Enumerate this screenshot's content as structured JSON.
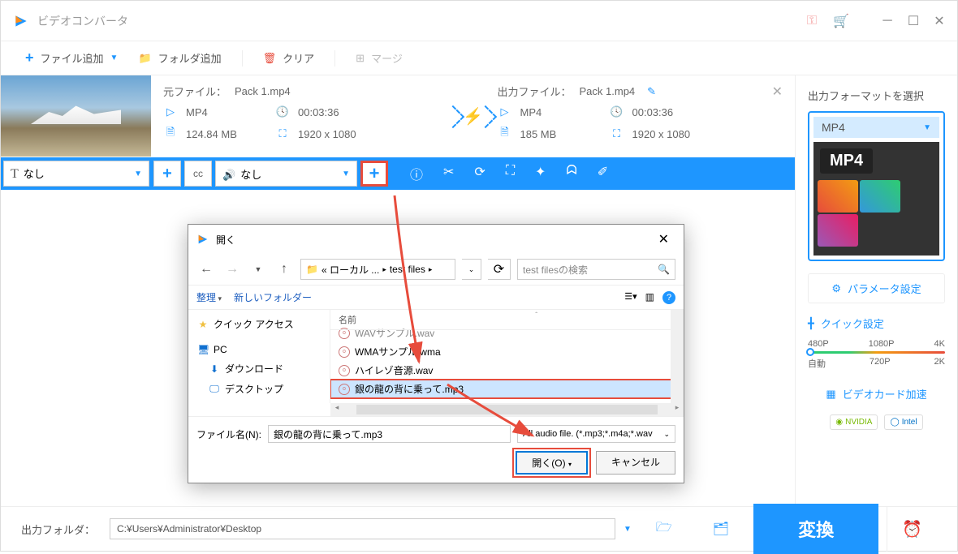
{
  "app": {
    "title": "ビデオコンバータ"
  },
  "toolbar": {
    "add_file": "ファイル追加",
    "add_folder": "フォルダ追加",
    "clear": "クリア",
    "merge": "マージ"
  },
  "file": {
    "source_label": "元ファイル：",
    "source_name": "Pack 1.mp4",
    "output_label": "出力ファイル：",
    "output_name": "Pack 1.mp4",
    "format": "MP4",
    "duration": "00:03:36",
    "src_size": "124.84 MB",
    "resolution": "1920 x 1080",
    "out_size": "185 MB"
  },
  "subtitle": {
    "none": "なし"
  },
  "audio": {
    "none": "なし"
  },
  "sidepanel": {
    "title": "出力フォーマットを選択",
    "format": "MP4",
    "param_btn": "パラメータ設定",
    "quick_title": "クイック設定",
    "res": {
      "p480": "480P",
      "p1080": "1080P",
      "k4": "4K",
      "auto": "自動",
      "p720": "720P",
      "k2": "2K"
    },
    "gpu": "ビデオカード加速",
    "nvidia": "NVIDIA",
    "intel": "Intel"
  },
  "bottom": {
    "label": "出力フォルダ：",
    "path": "C:¥Users¥Administrator¥Desktop",
    "convert": "変換"
  },
  "dialog": {
    "title": "開く",
    "breadcrumb1": "« ローカル ...",
    "breadcrumb2": "test files",
    "search_placeholder": "test filesの検索",
    "organize": "整理",
    "new_folder": "新しいフォルダー",
    "tree": {
      "quick": "クイック アクセス",
      "pc": "PC",
      "downloads": "ダウンロード",
      "desktop": "デスクトップ"
    },
    "col_name": "名前",
    "files": [
      "WAVサンプル.wav",
      "WMAサンプル.wma",
      "ハイレゾ音源.wav",
      "銀の龍の背に乗って.mp3"
    ],
    "fname_label": "ファイル名(N):",
    "fname_value": "銀の龍の背に乗って.mp3",
    "filter": "All audio file. (*.mp3;*.m4a;*.wav",
    "open_btn": "開く(O)",
    "cancel_btn": "キャンセル"
  }
}
